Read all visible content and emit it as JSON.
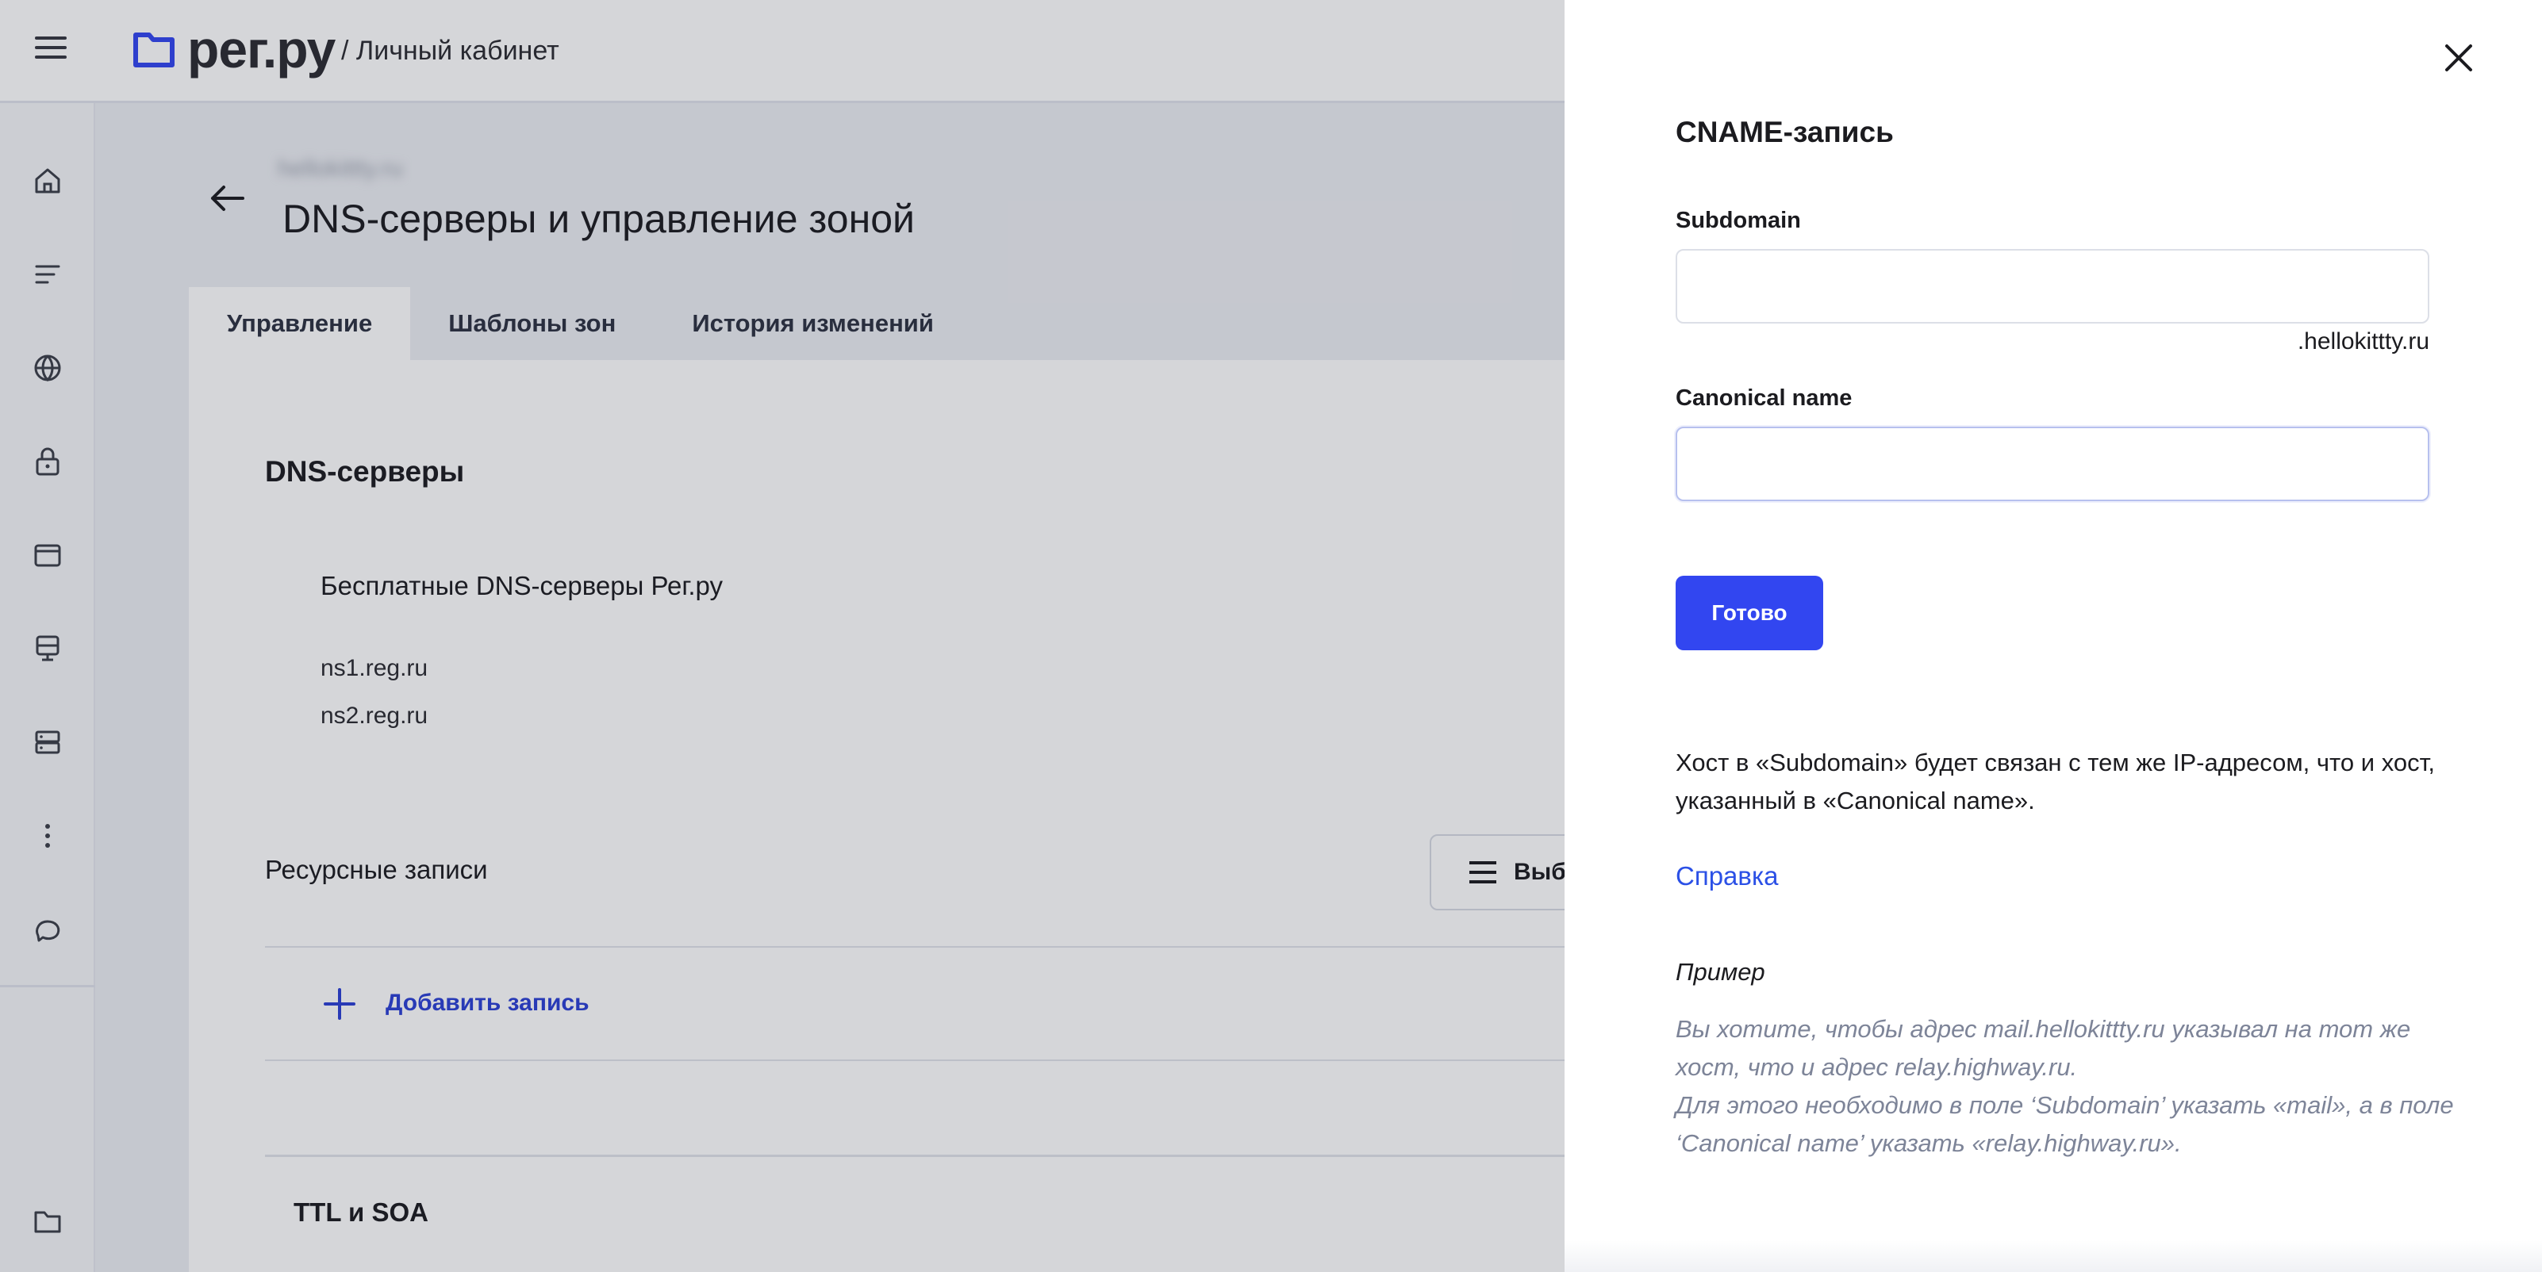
{
  "header": {
    "logo": "рег.ру",
    "subtitle": "/ Личный кабинет"
  },
  "page": {
    "domain": "hellokittty.ru",
    "title": "DNS-серверы и управление зоной",
    "tabs": [
      "Управление",
      "Шаблоны зон",
      "История изменений"
    ]
  },
  "dns_section": {
    "title": "DNS-серверы",
    "provider": "Бесплатные DNS-серверы Рег.ру",
    "servers": [
      "ns1.reg.ru",
      "ns2.reg.ru"
    ]
  },
  "records_section": {
    "title": "Ресурсные записи",
    "select_button": "Выбрать",
    "add_record": "Добавить запись"
  },
  "ttl_section": {
    "title": "TTL и SOA"
  },
  "drawer": {
    "title": "CNAME-запись",
    "subdomain_label": "Subdomain",
    "subdomain_value": "",
    "subdomain_suffix": ".hellokittty.ru",
    "canonical_label": "Canonical name",
    "canonical_value": "",
    "submit": "Готово",
    "description": "Хост в «Subdomain» будет связан с тем же IP-адресом, что и хост, указанный в «Canonical name».",
    "help_link": "Справка",
    "example_title": "Пример",
    "example_line1": "Вы хотите, чтобы адрес mail.hellokittty.ru указывал на тот же хост, что и адрес relay.highway.ru.",
    "example_line2": "Для этого необходимо в поле ‘Subdomain’ указать «mail», а в поле ‘Canonical name’ указать «relay.highway.ru»."
  },
  "colors": {
    "accent": "#3246f0",
    "link": "#2b50e6",
    "example_text": "#7d8498"
  }
}
